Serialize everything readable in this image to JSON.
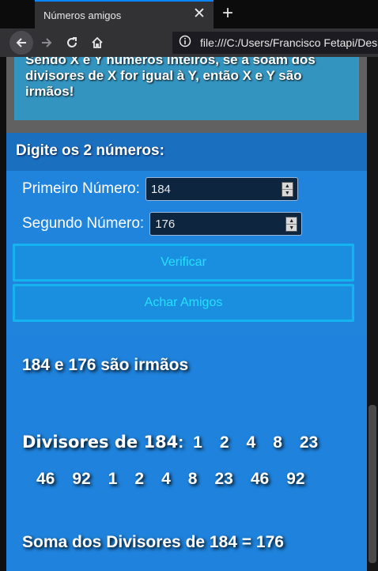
{
  "browser": {
    "tab_title": "Números amigos",
    "tab_close": "✕",
    "new_tab": "+",
    "url": "file:///C:/Users/Francisco Fetapi/Deskt"
  },
  "intro": {
    "text": "Sendo X e Y números inteiros, se a soam dos divisores de X for igual à Y, então X e Y são irmãos!"
  },
  "form": {
    "header": "Digite os 2 números:",
    "first_label": "Primeiro Número:",
    "first_value": "184",
    "second_label": "Segundo Número:",
    "second_value": "176",
    "verify_button": "Verificar",
    "friends_button": "Achar Amigos"
  },
  "result": {
    "title": "184 e 176 são irmãos",
    "divisors_label": "Divisores de 184",
    "divisors_separator": ":",
    "divisors": [
      "1",
      "2",
      "4",
      "8",
      "23",
      "46",
      "92",
      "1",
      "2",
      "4",
      "8",
      "23",
      "46",
      "92"
    ],
    "sum_line": "Soma dos Divisores de 184 = 176"
  },
  "colors": {
    "accent": "#2084dc",
    "button_border": "#14b4f0",
    "button_text": "#27e0ff"
  }
}
